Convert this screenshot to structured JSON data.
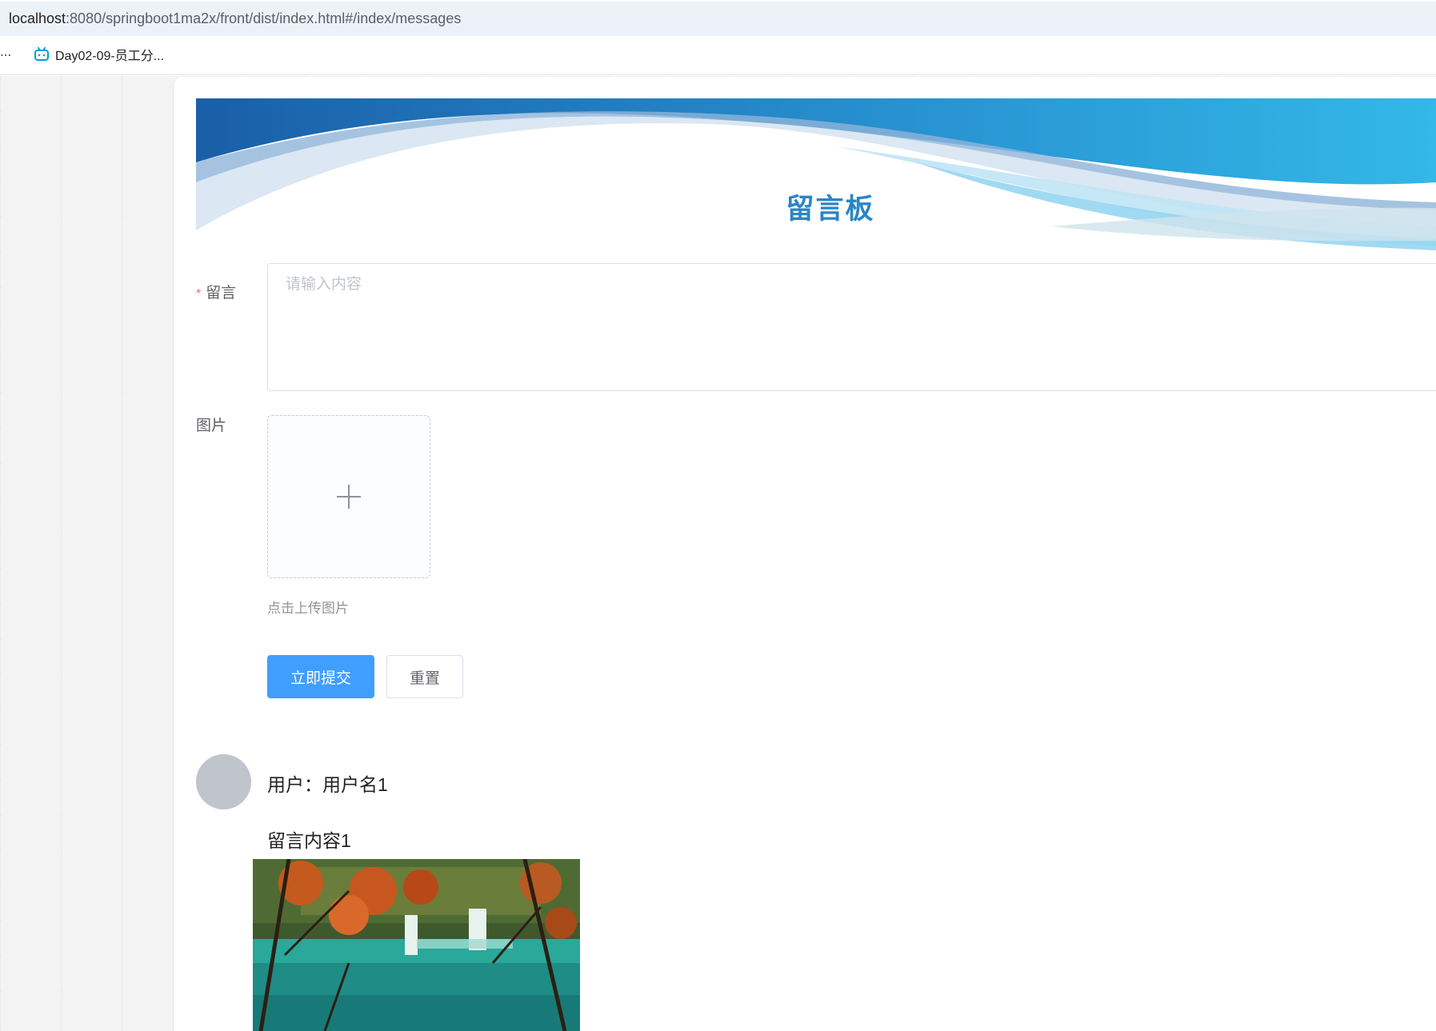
{
  "browser": {
    "url_host": "localhost",
    "url_rest": ":8080/springboot1ma2x/front/dist/index.html#/index/messages",
    "bookmarks": {
      "ellipsis": "...",
      "items": [
        {
          "label": "Day02-09-员工分...",
          "icon": "bilibili-tv-icon"
        }
      ]
    }
  },
  "page": {
    "title": "留言板",
    "form": {
      "message_label": "留言",
      "required_marker": "*",
      "message_placeholder": "请输入内容",
      "message_value": "",
      "image_label": "图片",
      "upload_icon": "plus-icon",
      "upload_tip": "点击上传图片",
      "submit_label": "立即提交",
      "reset_label": "重置"
    },
    "messages": [
      {
        "user": "用户：用户名1",
        "content": "留言内容1",
        "image": "autumn-lake-waterfall-photo"
      }
    ]
  },
  "colors": {
    "primary": "#409eff",
    "title": "#2a86c6",
    "required": "#f56c6c",
    "banner_dark": "#1a5fa8",
    "banner_light": "#33b8e8"
  }
}
